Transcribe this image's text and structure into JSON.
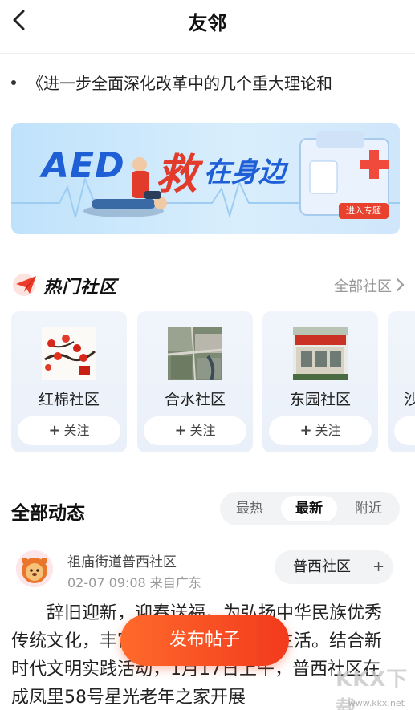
{
  "nav": {
    "title": "友邻",
    "back_icon": "chevron-left-icon"
  },
  "ticker": {
    "text": "《进一步全面深化改革中的几个重大理论和"
  },
  "banner": {
    "title_aed": "AED",
    "title_rest": "在身边",
    "title_key": "救",
    "cta": "进入专题"
  },
  "hot": {
    "title": "热门社区",
    "more": "全部社区",
    "communities": [
      {
        "name": "红棉社区",
        "follow": "关注"
      },
      {
        "name": "合水社区",
        "follow": "关注"
      },
      {
        "name": "东园社区",
        "follow": "关注"
      },
      {
        "name": "沙",
        "follow": ""
      }
    ]
  },
  "feed": {
    "title": "全部动态",
    "tabs": [
      {
        "label": "最热"
      },
      {
        "label": "最新"
      },
      {
        "label": "附近"
      }
    ],
    "active_tab": "最新",
    "post": {
      "author": "祖庙街道普西社区",
      "meta": "02-07 09:08  来自广东",
      "tag": "普西社区",
      "body": "辞旧迎新，迎春送福。为弘扬中华民族优秀传统文化，丰富辖区居民精神文化生活。结合新时代文明实践活动，1月17日上午，普西社区在成凤里58号星光老年之家开展"
    }
  },
  "publish_button": "发布帖子",
  "watermark": {
    "logo": "KKX下载",
    "url": "www.kkx.net"
  },
  "colors": {
    "accent": "#f23a1d",
    "banner_blue": "#1f5fd6",
    "banner_red": "#e23a2b"
  }
}
